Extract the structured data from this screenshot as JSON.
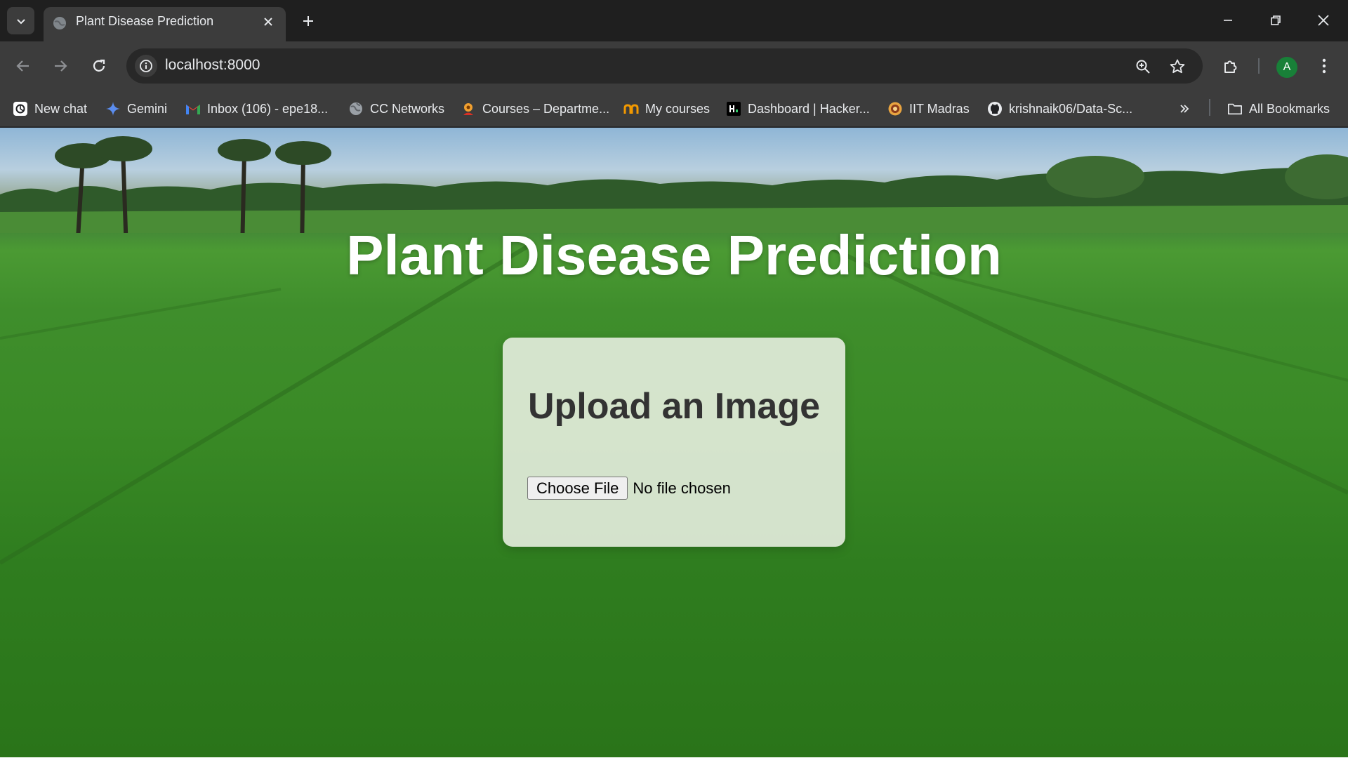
{
  "browser": {
    "tab": {
      "title": "Plant Disease Prediction"
    },
    "address_bar": {
      "url": "localhost:8000"
    },
    "profile_initial": "A",
    "bookmarks": [
      {
        "label": "New chat",
        "icon": "chatgpt-icon"
      },
      {
        "label": "Gemini",
        "icon": "gemini-icon"
      },
      {
        "label": "Inbox (106) - epe18...",
        "icon": "gmail-icon"
      },
      {
        "label": "CC Networks",
        "icon": "globe-icon"
      },
      {
        "label": "Courses – Departme...",
        "icon": "courses-icon"
      },
      {
        "label": "My courses",
        "icon": "mycourses-icon"
      },
      {
        "label": "Dashboard | Hacker...",
        "icon": "hackerrank-icon"
      },
      {
        "label": "IIT Madras",
        "icon": "iitm-icon"
      },
      {
        "label": "krishnaik06/Data-Sc...",
        "icon": "github-icon"
      }
    ],
    "all_bookmarks_label": "All Bookmarks"
  },
  "page": {
    "title": "Plant Disease Prediction",
    "upload_card": {
      "heading": "Upload an Image",
      "choose_file_label": "Choose File",
      "file_status": "No file chosen"
    }
  },
  "colors": {
    "accent_avatar": "#188038",
    "title_text": "#ffffff",
    "card_heading": "#333333"
  }
}
